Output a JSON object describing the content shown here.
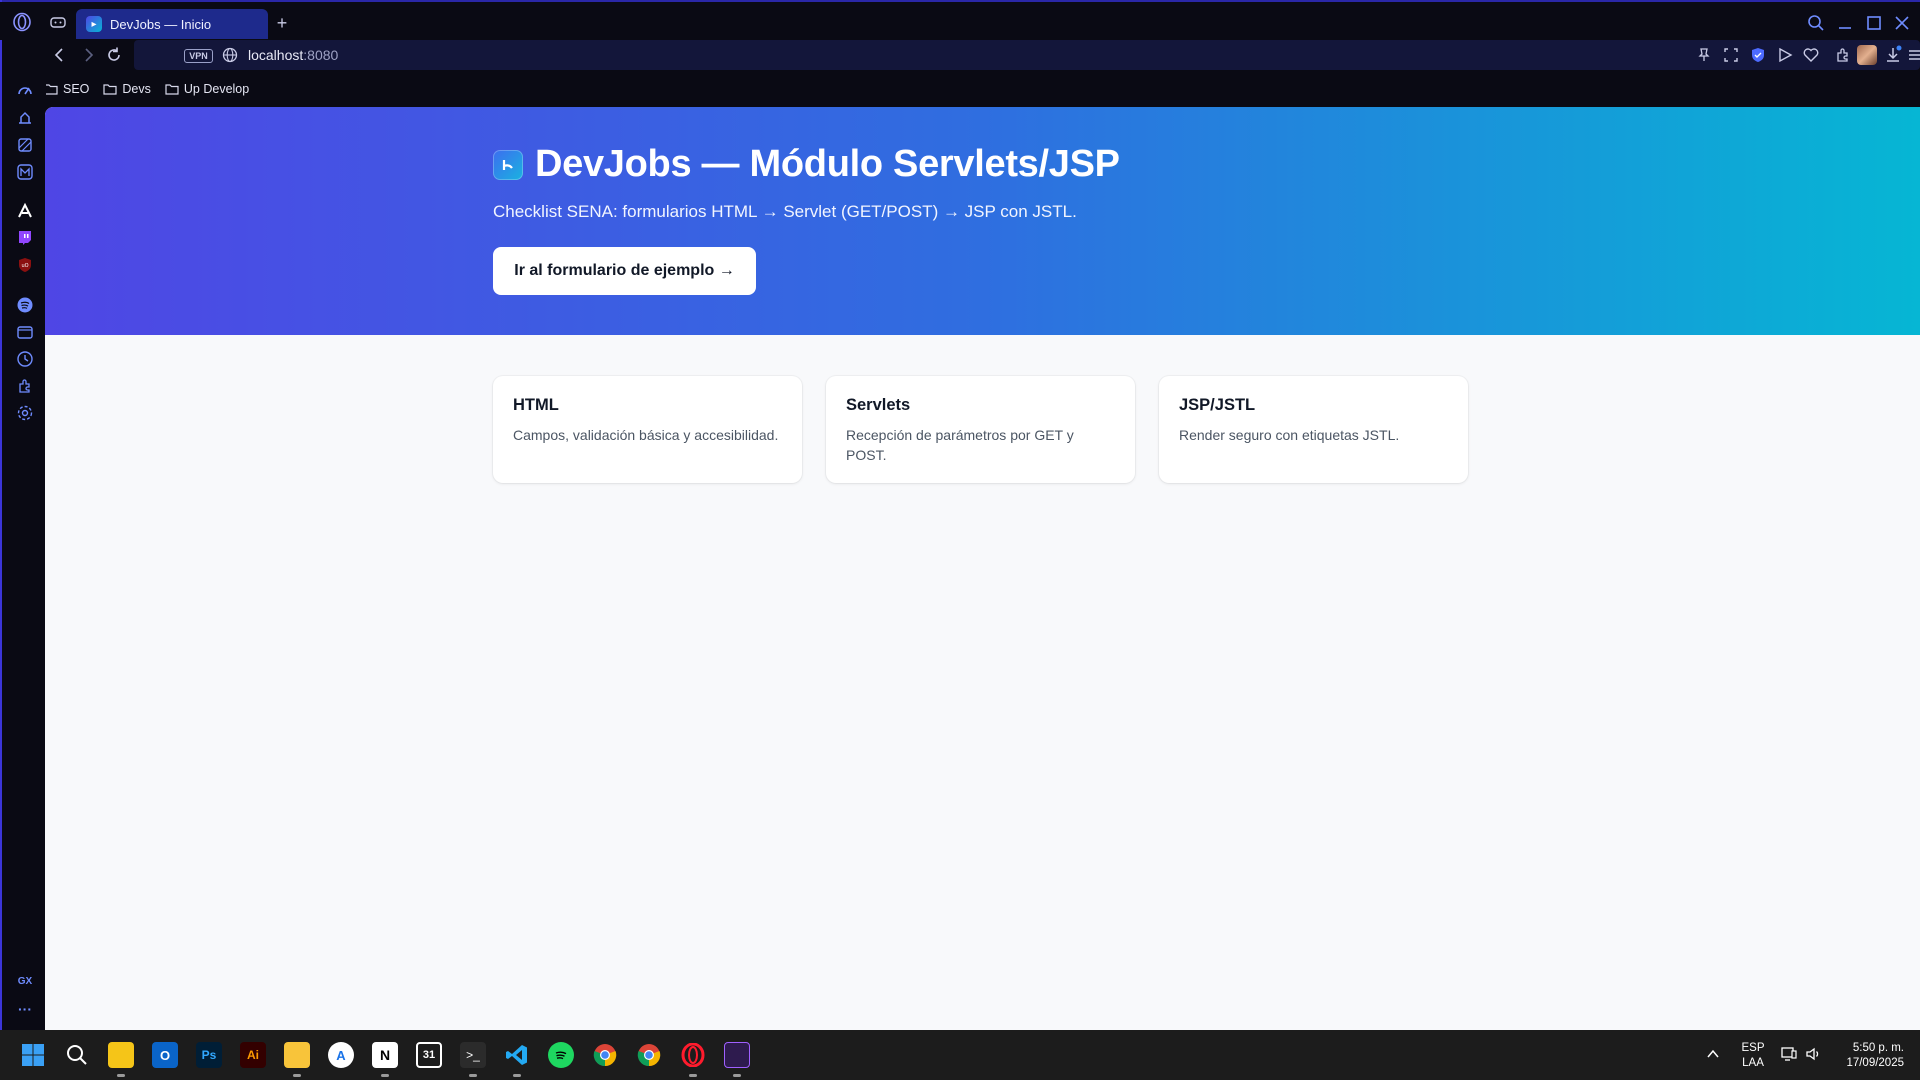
{
  "browser": {
    "tab": {
      "title": "DevJobs — Inicio",
      "favicon": "devjobs-logo-icon"
    },
    "newtab_label": "+",
    "url": {
      "vpn_label": "VPN",
      "host": "localhost",
      "port": ":8080"
    },
    "bookmarks": [
      {
        "label": "SEO",
        "icon": "folder-icon"
      },
      {
        "label": "Devs",
        "icon": "folder-icon"
      },
      {
        "label": "Up Develop",
        "icon": "folder-icon"
      }
    ],
    "sidebar_footer": {
      "gx_label": "GX",
      "more_label": "···"
    },
    "accent_color": "#3b35d8"
  },
  "page": {
    "hero": {
      "title": "DevJobs — Módulo Servlets/JSP",
      "subtitle": "Checklist SENA: formularios HTML → Servlet (GET/POST) → JSP con JSTL.",
      "cta_label": "Ir al formulario de ejemplo →",
      "gradient_start": "#4f46e5",
      "gradient_end": "#06b6d4"
    },
    "cards": [
      {
        "title": "HTML",
        "text": "Campos, validación básica y accesibilidad."
      },
      {
        "title": "Servlets",
        "text": "Recepción de parámetros por GET y POST."
      },
      {
        "title": "JSP/JSTL",
        "text": "Render seguro con etiquetas JSTL."
      }
    ]
  },
  "taskbar": {
    "lang": {
      "line1": "ESP",
      "line2": "LAA"
    },
    "clock": {
      "time": "5:50 p. m.",
      "date": "17/09/2025"
    }
  }
}
